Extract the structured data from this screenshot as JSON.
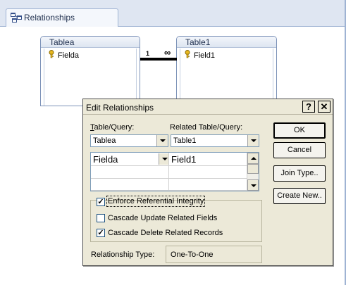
{
  "window": {
    "tab_title": "Relationships"
  },
  "tables": [
    {
      "name": "Tablea",
      "field": "Fielda"
    },
    {
      "name": "Table1",
      "field": "Field1"
    }
  ],
  "relationship_line": {
    "left_label": "1",
    "right_label": "∞"
  },
  "dialog": {
    "title": "Edit Relationships",
    "help_label": "?",
    "close_label": "✕",
    "table_query_label": "Table/Query:",
    "related_table_query_label": "Related Table/Query:",
    "table_query_value": "Tablea",
    "related_table_query_value": "Table1",
    "grid_rows": [
      {
        "left": "Fielda",
        "right": "Field1"
      },
      {
        "left": "",
        "right": ""
      },
      {
        "left": "",
        "right": ""
      }
    ],
    "buttons": {
      "ok": "OK",
      "cancel": "Cancel",
      "join_type": "Join Type..",
      "create_new": "Create New.."
    },
    "checkboxes": [
      {
        "label": "Enforce Referential Integrity",
        "checked": true
      },
      {
        "label": "Cascade Update Related Fields",
        "checked": false
      },
      {
        "label": "Cascade Delete Related Records",
        "checked": true
      }
    ],
    "relationship_type_label": "Relationship Type:",
    "relationship_type_value": "One-To-One"
  }
}
